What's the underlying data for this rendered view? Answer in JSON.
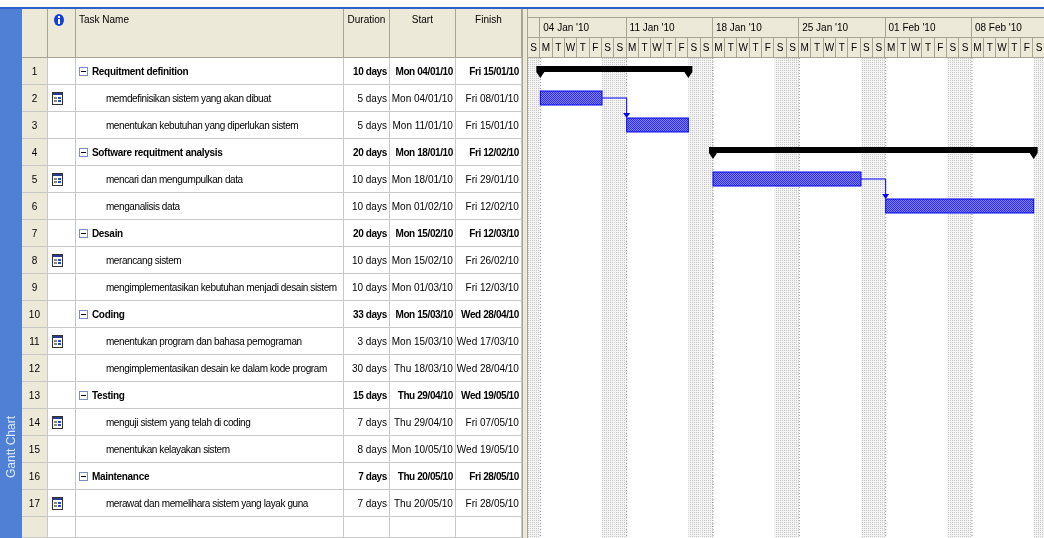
{
  "view_bar": {
    "label": "Gantt Chart"
  },
  "table": {
    "columns": {
      "name": "Task Name",
      "duration": "Duration",
      "start": "Start",
      "finish": "Finish"
    },
    "rows": [
      {
        "id": "1",
        "kind": "summary",
        "expanded": true,
        "has_note": false,
        "name": "Requitment definition",
        "duration": "10 days",
        "start": "Mon 04/01/10",
        "finish": "Fri 15/01/10"
      },
      {
        "id": "2",
        "kind": "task",
        "has_note": true,
        "name": "memdefinisikan sistem yang akan dibuat",
        "duration": "5 days",
        "start": "Mon 04/01/10",
        "finish": "Fri 08/01/10",
        "linked_to_previous": false
      },
      {
        "id": "3",
        "kind": "task",
        "has_note": false,
        "name": "menentukan kebutuhan yang diperlukan sistem",
        "duration": "5 days",
        "start": "Mon 11/01/10",
        "finish": "Fri 15/01/10",
        "linked_to_previous": true
      },
      {
        "id": "4",
        "kind": "summary",
        "expanded": true,
        "has_note": false,
        "name": "Software requitment analysis",
        "duration": "20 days",
        "start": "Mon 18/01/10",
        "finish": "Fri 12/02/10"
      },
      {
        "id": "5",
        "kind": "task",
        "has_note": true,
        "name": "mencari dan mengumpulkan data",
        "duration": "10 days",
        "start": "Mon 18/01/10",
        "finish": "Fri 29/01/10",
        "linked_to_previous": false
      },
      {
        "id": "6",
        "kind": "task",
        "has_note": false,
        "name": "menganalisis data",
        "duration": "10 days",
        "start": "Mon 01/02/10",
        "finish": "Fri 12/02/10",
        "linked_to_previous": true
      },
      {
        "id": "7",
        "kind": "summary",
        "expanded": true,
        "has_note": false,
        "name": "Desain",
        "duration": "20 days",
        "start": "Mon 15/02/10",
        "finish": "Fri 12/03/10"
      },
      {
        "id": "8",
        "kind": "task",
        "has_note": true,
        "name": "merancang sistem",
        "duration": "10 days",
        "start": "Mon 15/02/10",
        "finish": "Fri 26/02/10"
      },
      {
        "id": "9",
        "kind": "task",
        "has_note": false,
        "name": "mengimplementasikan kebutuhan menjadi desain sistem",
        "duration": "10 days",
        "start": "Mon 01/03/10",
        "finish": "Fri 12/03/10"
      },
      {
        "id": "10",
        "kind": "summary",
        "expanded": true,
        "has_note": false,
        "name": "Coding",
        "duration": "33 days",
        "start": "Mon 15/03/10",
        "finish": "Wed 28/04/10"
      },
      {
        "id": "11",
        "kind": "task",
        "has_note": true,
        "name": "menentukan program dan bahasa pemograman",
        "duration": "3 days",
        "start": "Mon 15/03/10",
        "finish": "Wed 17/03/10"
      },
      {
        "id": "12",
        "kind": "task",
        "has_note": false,
        "name": "mengimplementasikan desain ke dalam kode program",
        "duration": "30 days",
        "start": "Thu 18/03/10",
        "finish": "Wed 28/04/10"
      },
      {
        "id": "13",
        "kind": "summary",
        "expanded": true,
        "has_note": false,
        "name": "Testing",
        "duration": "15 days",
        "start": "Thu 29/04/10",
        "finish": "Wed 19/05/10"
      },
      {
        "id": "14",
        "kind": "task",
        "has_note": true,
        "name": "menguji sistem yang telah di coding",
        "duration": "7 days",
        "start": "Thu 29/04/10",
        "finish": "Fri 07/05/10"
      },
      {
        "id": "15",
        "kind": "task",
        "has_note": false,
        "name": "menentukan kelayakan sistem",
        "duration": "8 days",
        "start": "Mon 10/05/10",
        "finish": "Wed 19/05/10"
      },
      {
        "id": "16",
        "kind": "summary",
        "expanded": true,
        "has_note": false,
        "name": "Maintenance",
        "duration": "7 days",
        "start": "Thu 20/05/10",
        "finish": "Fri 28/05/10"
      },
      {
        "id": "17",
        "kind": "task",
        "has_note": true,
        "name": "merawat dan memelihara sistem yang layak guna",
        "duration": "7 days",
        "start": "Thu 20/05/10",
        "finish": "Fri 28/05/10"
      }
    ]
  },
  "timescale": {
    "weeks": [
      "04 Jan '10",
      "11 Jan '10",
      "18 Jan '10",
      "25 Jan '10",
      "01 Feb '10",
      "08 Feb '10"
    ],
    "days": [
      "S",
      "M",
      "T",
      "W",
      "T",
      "F",
      "S",
      "S",
      "M",
      "T",
      "W",
      "T",
      "F",
      "S",
      "S",
      "M",
      "T",
      "W",
      "T",
      "F",
      "S",
      "S",
      "M",
      "T",
      "W",
      "T",
      "F",
      "S",
      "S",
      "M",
      "T",
      "W",
      "T",
      "F",
      "S",
      "S",
      "M",
      "T",
      "W",
      "T",
      "F",
      "S"
    ]
  }
}
